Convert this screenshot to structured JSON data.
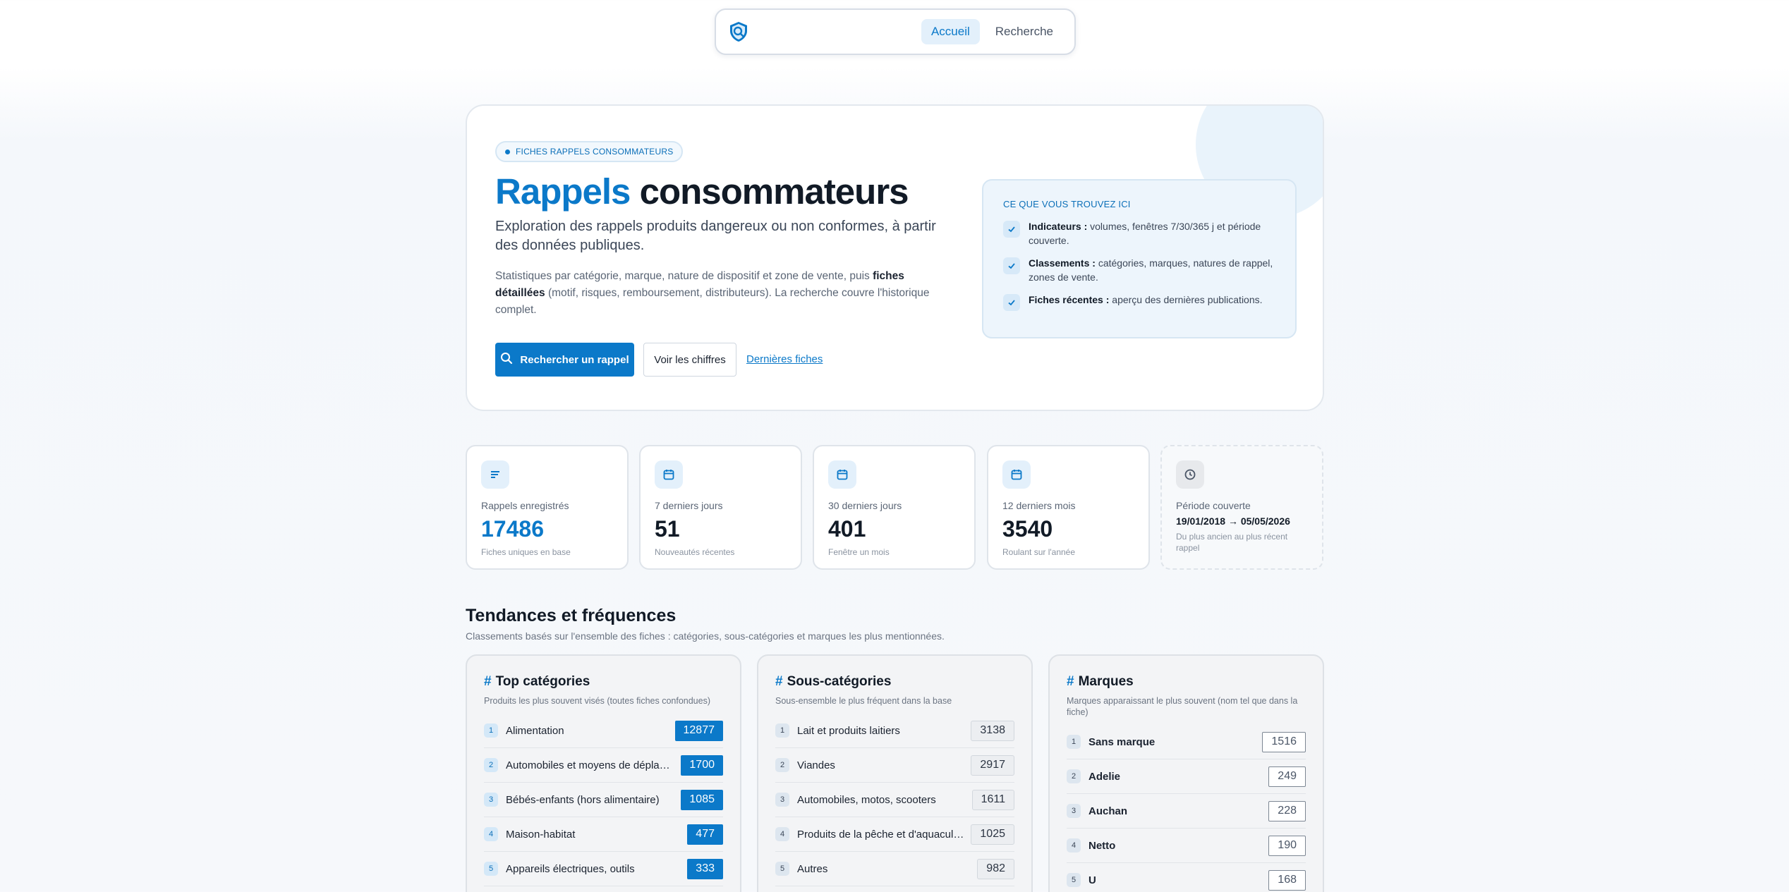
{
  "nav": {
    "logo_icon": "shield-search-icon",
    "links": [
      {
        "label": "Accueil",
        "active": true
      },
      {
        "label": "Recherche",
        "active": false
      }
    ]
  },
  "hero": {
    "pill": "FICHES RAPPELS CONSOMMATEURS",
    "title_accent": "Rappels",
    "title_rest": "consommateurs",
    "lead": "Exploration des rappels produits dangereux ou non conformes, à partir des données publiques.",
    "desc_before": "Statistiques par catégorie, marque, nature de dispositif et zone de vente, puis ",
    "desc_bold": "fiches détaillées",
    "desc_after": " (motif, risques, remboursement, distributeurs). La recherche couvre l'historique complet.",
    "btn_search": "Rechercher un rappel",
    "btn_numbers": "Voir les chiffres",
    "link_latest": "Dernières fiches",
    "panel": {
      "title": "CE QUE VOUS TROUVEZ ICI",
      "items": [
        {
          "bold": "Indicateurs :",
          "text": " volumes, fenêtres 7/30/365 j et période couverte."
        },
        {
          "bold": "Classements :",
          "text": " catégories, marques, natures de rappel, zones de vente."
        },
        {
          "bold": "Fiches récentes :",
          "text": " aperçu des dernières publications."
        }
      ]
    }
  },
  "stats": [
    {
      "icon": "list-icon",
      "label": "Rappels enregistrés",
      "value": "17486",
      "sub": "Fiches uniques en base"
    },
    {
      "icon": "calendar-icon",
      "label": "7 derniers jours",
      "value": "51",
      "sub": "Nouveautés récentes"
    },
    {
      "icon": "calendar-icon",
      "label": "30 derniers jours",
      "value": "401",
      "sub": "Fenêtre un mois"
    },
    {
      "icon": "calendar-icon",
      "label": "12 derniers mois",
      "value": "3540",
      "sub": "Roulant sur l'année"
    },
    {
      "icon": "clock-icon",
      "label": "Période couverte",
      "range": "19/01/2018 → 05/05/2026",
      "sub": "Du plus ancien au plus récent rappel"
    }
  ],
  "trends": {
    "title": "Tendances et fréquences",
    "subtitle": "Classements basés sur l'ensemble des fiches : catégories, sous-catégories et marques les plus mentionnées.",
    "cards": [
      {
        "title": "Top catégories",
        "subtitle": "Produits les plus souvent visés (toutes fiches confondues)",
        "rows": [
          {
            "rank": "1",
            "label": "Alimentation",
            "value": "12877"
          },
          {
            "rank": "2",
            "label": "Automobiles et moyens de déplacement",
            "value": "1700"
          },
          {
            "rank": "3",
            "label": "Bébés-enfants (hors alimentaire)",
            "value": "1085"
          },
          {
            "rank": "4",
            "label": "Maison-habitat",
            "value": "477"
          },
          {
            "rank": "5",
            "label": "Appareils électriques, outils",
            "value": "333"
          }
        ]
      },
      {
        "title": "Sous-catégories",
        "subtitle": "Sous-ensemble le plus fréquent dans la base",
        "rows": [
          {
            "rank": "1",
            "label": "Lait et produits laitiers",
            "value": "3138"
          },
          {
            "rank": "2",
            "label": "Viandes",
            "value": "2917"
          },
          {
            "rank": "3",
            "label": "Automobiles, motos, scooters",
            "value": "1611"
          },
          {
            "rank": "4",
            "label": "Produits de la pêche et d'aquaculture",
            "value": "1025"
          },
          {
            "rank": "5",
            "label": "Autres",
            "value": "982"
          }
        ]
      },
      {
        "title": "Marques",
        "subtitle": "Marques apparaissant le plus souvent (nom tel que dans la fiche)",
        "rows": [
          {
            "rank": "1",
            "label": "Sans marque",
            "value": "1516"
          },
          {
            "rank": "2",
            "label": "Adelie",
            "value": "249"
          },
          {
            "rank": "3",
            "label": "Auchan",
            "value": "228"
          },
          {
            "rank": "4",
            "label": "Netto",
            "value": "190"
          },
          {
            "rank": "5",
            "label": "U",
            "value": "168"
          }
        ]
      }
    ]
  },
  "colors": {
    "accent": "#0b79c9",
    "accent_light": "#e3f0fb"
  }
}
